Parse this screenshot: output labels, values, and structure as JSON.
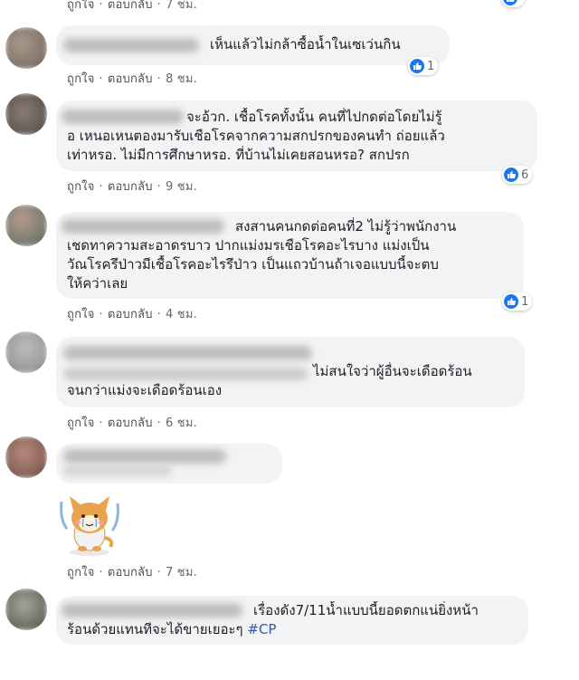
{
  "comment_actions": {
    "like": "ถูกใจ",
    "reply": "ตอบกลับ",
    "separator": "·"
  },
  "comments": [
    {
      "time": "7 ชม."
    },
    {
      "lines": [
        "เห็นแล้วไม่กล้าซื้อน้ำในเซเว่นกิน"
      ],
      "reactions": "1",
      "time": "8 ชม."
    },
    {
      "lines": [
        "จะอ้วก. เชื้อโรคทั้งนั้น คนที่ไปกดต่อโดยไม่รู้",
        "อ เหนอเหนตองมารับเชือโรคจากความสกปรกของคนทำ ถ่อยแล้ว",
        "เท่าหรอ. ไม่มีการศึกษาหรอ. ที่บ้านไม่เคยสอนหรอ? สกปรก"
      ],
      "reactions": "6",
      "time": "9 ชม."
    },
    {
      "lines": [
        "สงสานคนกดต่อคนที่2 ไม่รู้ว่าพนักงาน",
        "เชดทาความสะอาดรบาว ปากแม่งมรเชือโรคอะไรบาง แม่งเป็น",
        "วัณโรครึป่าวมีเชื้อโรคอะไรรึป่าว เป็นแถวบ้านถ้าเจอแบบนี้จะตบ",
        "ให้คว่าเลย"
      ],
      "reactions": "1",
      "time": "4 ชม."
    },
    {
      "lines": [
        "ไม่สนใจว่าผู้อื่นจะเดือดร้อน",
        "จนกว่าแม่งจะเดือดร้อนเอง"
      ],
      "time": "6 ชม."
    },
    {
      "sticker": "crying-dog-sticker",
      "time": "7 ชม."
    },
    {
      "lines": [
        "เรื่องดัง7/11น้ำแบบนี้ยอดตกแน่ยิ่งหน้า",
        "ร้อนด้วยแทนทีจะได้ขายเยอะๆ"
      ],
      "hashtag": "#CP"
    }
  ],
  "colors": {
    "accent": "#1877f2",
    "bubble": "#f2f3f5",
    "meta": "#606770",
    "hashtag": "#385898"
  }
}
